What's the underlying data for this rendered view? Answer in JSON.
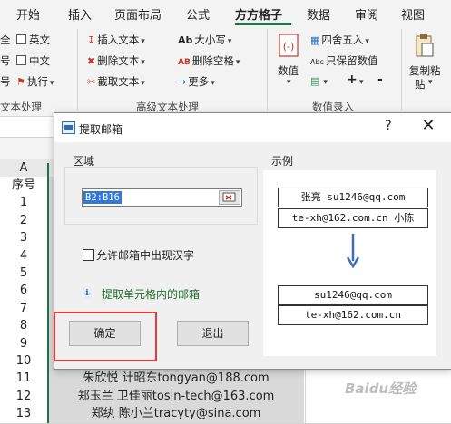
{
  "ribbon": {
    "tabs": [
      "开始",
      "插入",
      "页面布局",
      "公式",
      "方方格子",
      "数据",
      "审阅",
      "视图"
    ],
    "active_tab": "方方格子",
    "left_items": [
      "英文",
      "中文",
      "执行"
    ],
    "left_frag_1": "全",
    "left_frag_2": "号",
    "left_frag_3": "号",
    "text_group": {
      "insert_text": "插入文本",
      "delete_text": "删除文本",
      "cut_text": "截取文本",
      "case": "大小写",
      "delete_space": "删除空格",
      "more": "更多"
    },
    "number_group": {
      "number_label": "数值",
      "round": "四舍五入",
      "keep_numeric": "只保留数值",
      "plus": "+",
      "minus": "-"
    },
    "paste": {
      "line1": "复制粘",
      "line2": "贴"
    },
    "group_labels": {
      "text_proc_left": "文本处理",
      "advanced_text": "高级文本处理",
      "number_entry": "数值录入"
    },
    "icons": {
      "case": "Ab",
      "delete_space": "AB",
      "keep_numeric": "Abc"
    }
  },
  "sheet": {
    "col_a": "A",
    "rows": [
      {
        "num": "序号",
        "content": ""
      },
      {
        "num": "1",
        "content": ""
      },
      {
        "num": "2",
        "content": ""
      },
      {
        "num": "3",
        "content": ""
      },
      {
        "num": "4",
        "content": ""
      },
      {
        "num": "5",
        "content": ""
      },
      {
        "num": "6",
        "content": ""
      },
      {
        "num": "7",
        "content": ""
      },
      {
        "num": "8",
        "content": ""
      },
      {
        "num": "9",
        "content": ""
      },
      {
        "num": "10",
        "content": ""
      },
      {
        "num": "11",
        "content": "朱欣悦 计昭东tongyan@188.com"
      },
      {
        "num": "12",
        "content": "郑玉兰 卫佳丽tosin-tech@163.com"
      },
      {
        "num": "13",
        "content": "郑纨 陈小兰tracyty@sina.com"
      }
    ],
    "watermark": "Baidu经验"
  },
  "dialog": {
    "title": "提取邮箱",
    "help": "?",
    "close": "✕",
    "area_label": "区域",
    "range_value": "B2:B16",
    "allow_chinese": "允许邮箱中出现汉字",
    "info": "提取单元格内的邮箱",
    "ok": "确定",
    "exit": "退出",
    "example_label": "示例",
    "example_input": [
      "张亮 su1246@qq.com",
      "te-xh@162.com.cn 小陈"
    ],
    "example_output": [
      "su1246@qq.com",
      "te-xh@162.com.cn"
    ]
  }
}
